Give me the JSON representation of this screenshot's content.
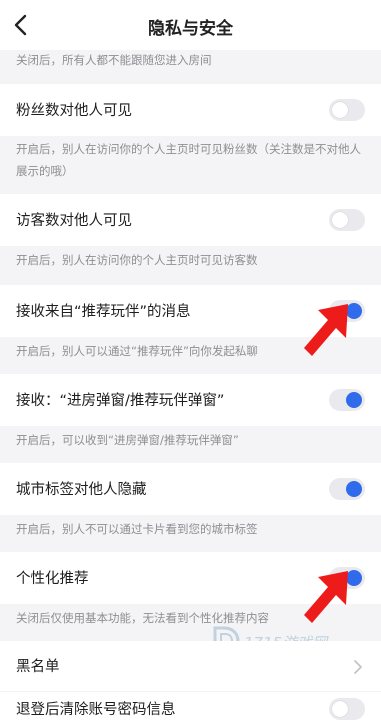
{
  "header": {
    "title": "隐私与安全"
  },
  "notes": {
    "top": "关闭后，所有人都不能跟随您进入房间",
    "fans": "开启后，别人在访问你的个人主页时可见粉丝数（关注数是不对他人展示的哦）",
    "visitors": "开启后，别人在访问你的个人主页时可见访客数",
    "recommend_msg": "开启后，别人可以通过“推荐玩伴”向你发起私聊",
    "popup": "开启后，可以收到“进房弹窗/推荐玩伴弹窗”",
    "city": "开启后，别人不可以通过卡片看到您的城市标签",
    "personalized": "关闭后仅使用基本功能，无法看到个性化推荐内容"
  },
  "rows": {
    "fans": {
      "label": "粉丝数对他人可见",
      "toggle_on": false
    },
    "visitors": {
      "label": "访客数对他人可见",
      "toggle_on": false
    },
    "recommend_msg": {
      "label": "接收来自“推荐玩伴”的消息",
      "toggle_on": true
    },
    "popup": {
      "label": "接收：“进房弹窗/推荐玩伴弹窗”",
      "toggle_on": true
    },
    "city": {
      "label": "城市标签对他人隐藏",
      "toggle_on": true
    },
    "personalized": {
      "label": "个性化推荐",
      "toggle_on": true
    },
    "blacklist": {
      "label": "黑名单"
    },
    "clear_account": {
      "label": "退登后清除账号密码信息",
      "toggle_on": false
    }
  },
  "watermark": {
    "text": "1715游戏网"
  },
  "colors": {
    "accent": "#2f6bea",
    "toggle_off": "#e9e9ee",
    "arrow": "#ee1b1b",
    "note_text": "#8e8e93",
    "background": "#f4f4f6"
  },
  "icons": {
    "back": "chevron-left-icon",
    "blacklist": "chevron-right-icon",
    "annotation": "red-arrow-icon"
  }
}
